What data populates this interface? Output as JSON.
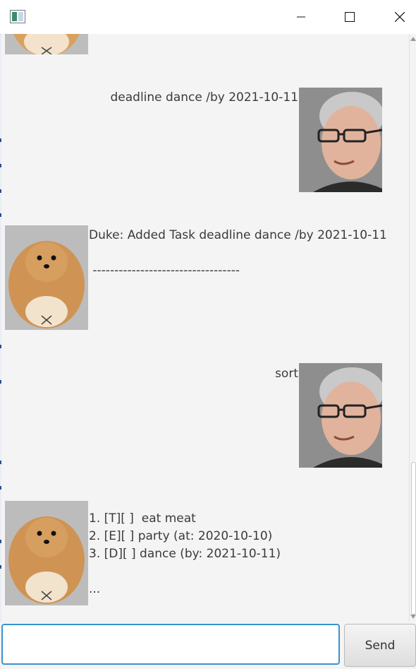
{
  "window": {
    "app_icon": "java-app-icon",
    "controls": {
      "minimize": "minimize-icon",
      "maximize": "maximize-icon",
      "close": "close-icon"
    }
  },
  "messages": [
    {
      "sender": "duke",
      "avatar": "dog-avatar",
      "text": ""
    },
    {
      "sender": "user",
      "avatar": "user-avatar",
      "text": "deadline dance /by 2021-10-11"
    },
    {
      "sender": "duke",
      "avatar": "dog-avatar",
      "text": "Duke: Added Task deadline dance /by 2021-10-11\n\n ----------------------------------"
    },
    {
      "sender": "user",
      "avatar": "user-avatar",
      "text": "sort"
    },
    {
      "sender": "duke",
      "avatar": "dog-avatar",
      "text": "1. [T][ ]  eat meat\n2. [E][ ] party (at: 2020-10-10)\n3. [D][ ] dance (by: 2021-10-11)\n\n..."
    }
  ],
  "input": {
    "value": "",
    "placeholder": ""
  },
  "send_button": {
    "label": "Send"
  },
  "colors": {
    "input_focus": "#3a92cf",
    "background": "#f4f4f4"
  }
}
